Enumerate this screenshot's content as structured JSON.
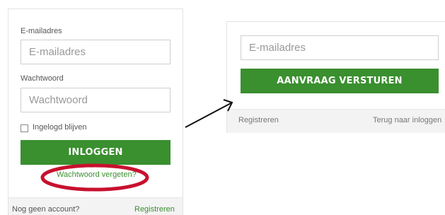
{
  "login": {
    "email_label": "E-mailadres",
    "email_placeholder": "E-mailadres",
    "password_label": "Wachtwoord",
    "password_placeholder": "Wachtwoord",
    "remember_label": "Ingelogd blijven",
    "login_button": "INLOGGEN",
    "forgot_link": "Wachtwoord vergeten?",
    "no_account_text": "Nog geen account?",
    "register_link": "Registreren"
  },
  "forgot": {
    "email_placeholder": "E-mailadres",
    "submit_button": "AANVRAAG VERSTUREN",
    "register_link": "Registreren",
    "back_link": "Terug naar inloggen"
  },
  "colors": {
    "button_green": "#3a8f2f",
    "annotation_red": "#c8102e"
  }
}
